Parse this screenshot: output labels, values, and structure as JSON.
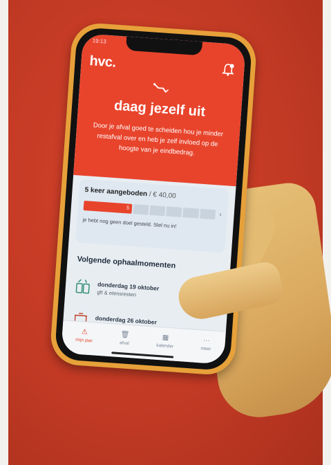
{
  "status": {
    "time": "19:13",
    "right": ""
  },
  "header": {
    "brand": "hvc.",
    "title": "daag jezelf uit",
    "body": "Door je afval goed te scheiden hou je minder restafval over en heb je zelf invloed op de hoogte van je eindbedrag."
  },
  "offer": {
    "count_text": "5 keer aangeboden",
    "price_text": "/ € 40,00",
    "progress_label": "5",
    "note": "je hebt nog geen doel gesteld. Stel nu in!",
    "progress_fraction": 0.3
  },
  "pickups": {
    "title": "Volgende ophaalmomenten",
    "items": [
      {
        "date": "donderdag 19 oktober",
        "type": "gft & etensresten",
        "icon": "gft-bin-icon"
      },
      {
        "date": "donderdag 26 oktober",
        "type": "",
        "icon": "restafval-bin-icon"
      }
    ]
  },
  "tabs": [
    {
      "label": "mijn jaar",
      "icon": "warning-icon",
      "active": true
    },
    {
      "label": "afval",
      "icon": "trash-icon",
      "active": false
    },
    {
      "label": "kalender",
      "icon": "calendar-icon",
      "active": false
    },
    {
      "label": "meer",
      "icon": "more-icon",
      "active": false
    }
  ],
  "colors": {
    "accent": "#e8442c",
    "phone_case": "#e7a13a",
    "card": "#dfe8f1"
  }
}
